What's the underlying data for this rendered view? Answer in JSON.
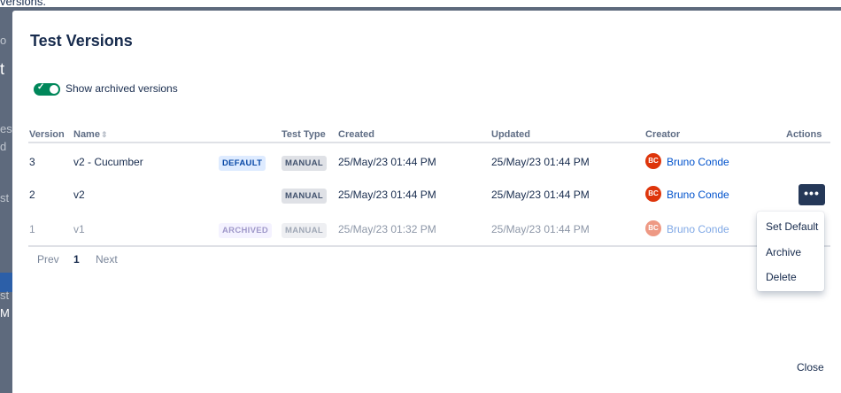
{
  "page_fragment": "versions.",
  "background_fragments": [
    "o",
    "t",
    "es",
    "d",
    "st",
    "st",
    "M"
  ],
  "modal": {
    "title": "Test Versions",
    "toggle": {
      "label": "Show archived versions",
      "on": true
    }
  },
  "table": {
    "headers": [
      "Version",
      "Name",
      "Test Type",
      "Created",
      "Updated",
      "Creator",
      "Actions"
    ],
    "rows": [
      {
        "version": "3",
        "name": "v2 - Cucumber",
        "badge": "DEFAULT",
        "test_type": "MANUAL",
        "created": "25/May/23 01:44 PM",
        "updated": "25/May/23 01:44 PM",
        "avatar": "BC",
        "creator": "Bruno Conde",
        "archived": false
      },
      {
        "version": "2",
        "name": "v2",
        "badge": "",
        "test_type": "MANUAL",
        "created": "25/May/23 01:44 PM",
        "updated": "25/May/23 01:44 PM",
        "avatar": "BC",
        "creator": "Bruno Conde",
        "archived": false
      },
      {
        "version": "1",
        "name": "v1",
        "badge": "ARCHIVED",
        "test_type": "MANUAL",
        "created": "25/May/23 01:32 PM",
        "updated": "25/May/23 01:44 PM",
        "avatar": "BC",
        "creator": "Bruno Conde",
        "archived": true
      }
    ]
  },
  "actions_button": "•••",
  "actions_menu": [
    "Set Default",
    "Archive",
    "Delete"
  ],
  "pagination": {
    "prev": "Prev",
    "current": "1",
    "next": "Next"
  },
  "footer": {
    "close": "Close"
  },
  "colors": {
    "toggle_on": "#00875a",
    "avatar": "#de350b",
    "link": "#0052cc",
    "more_button": "#253858"
  }
}
